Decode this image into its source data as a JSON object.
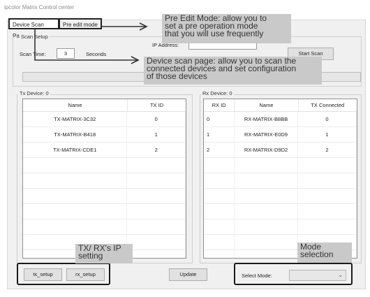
{
  "window": {
    "title": "ipcolor Matrix Control center"
  },
  "tabs": [
    {
      "label": "Device Scan Page"
    },
    {
      "label": "Pre edit mode"
    }
  ],
  "scan_setup": {
    "group_label": "Scan Setup",
    "scan_time_label": "Scan Time:",
    "scan_time_value": "3",
    "seconds_label": "Seconds",
    "ip_address_label": "IP Address:",
    "ip_address_value": "",
    "start_scan_label": "Start Scan"
  },
  "tx": {
    "group_label": "Tx Device: 0",
    "columns": [
      "Name",
      "TX ID"
    ],
    "rows": [
      {
        "name": "TX-MATRIX-3C32",
        "id": "0"
      },
      {
        "name": "TX-MATRIX-B418",
        "id": "1"
      },
      {
        "name": "TX-MATRIX-CDE1",
        "id": "2"
      }
    ]
  },
  "rx": {
    "group_label": "Rx Device: 0",
    "columns": [
      "RX ID",
      "Name",
      "TX Connected"
    ],
    "rows": [
      {
        "id": "0",
        "name": "RX-MATRIX-B8BB",
        "tx": "0"
      },
      {
        "id": "1",
        "name": "RX-MATRIX-E0D9",
        "tx": "1"
      },
      {
        "id": "2",
        "name": "RX-MATRIX-D9D2",
        "tx": "2"
      }
    ]
  },
  "bottom": {
    "tx_setup_label": "tx_setup",
    "rx_setup_label": "rx_setup",
    "update_label": "Update",
    "select_mode_label": "Select Mode:",
    "select_mode_value": ""
  },
  "annotations": {
    "pre_edit": [
      "Pre Edit Mode: allow you to",
      "set a pre operation mode",
      "that you will use frequently"
    ],
    "device_scan": [
      "Device scan page:  allow you to scan the",
      "connected devices and set configuration",
      "of those devices"
    ],
    "ip_setting": [
      "TX/ RX's IP",
      "setting"
    ],
    "mode_selection": [
      "Mode",
      "selection"
    ]
  },
  "colors": {
    "callout_bg": "#c9c9c9",
    "highlight_border": "#1a1a1a",
    "panel_bg": "#f0f0f0"
  }
}
